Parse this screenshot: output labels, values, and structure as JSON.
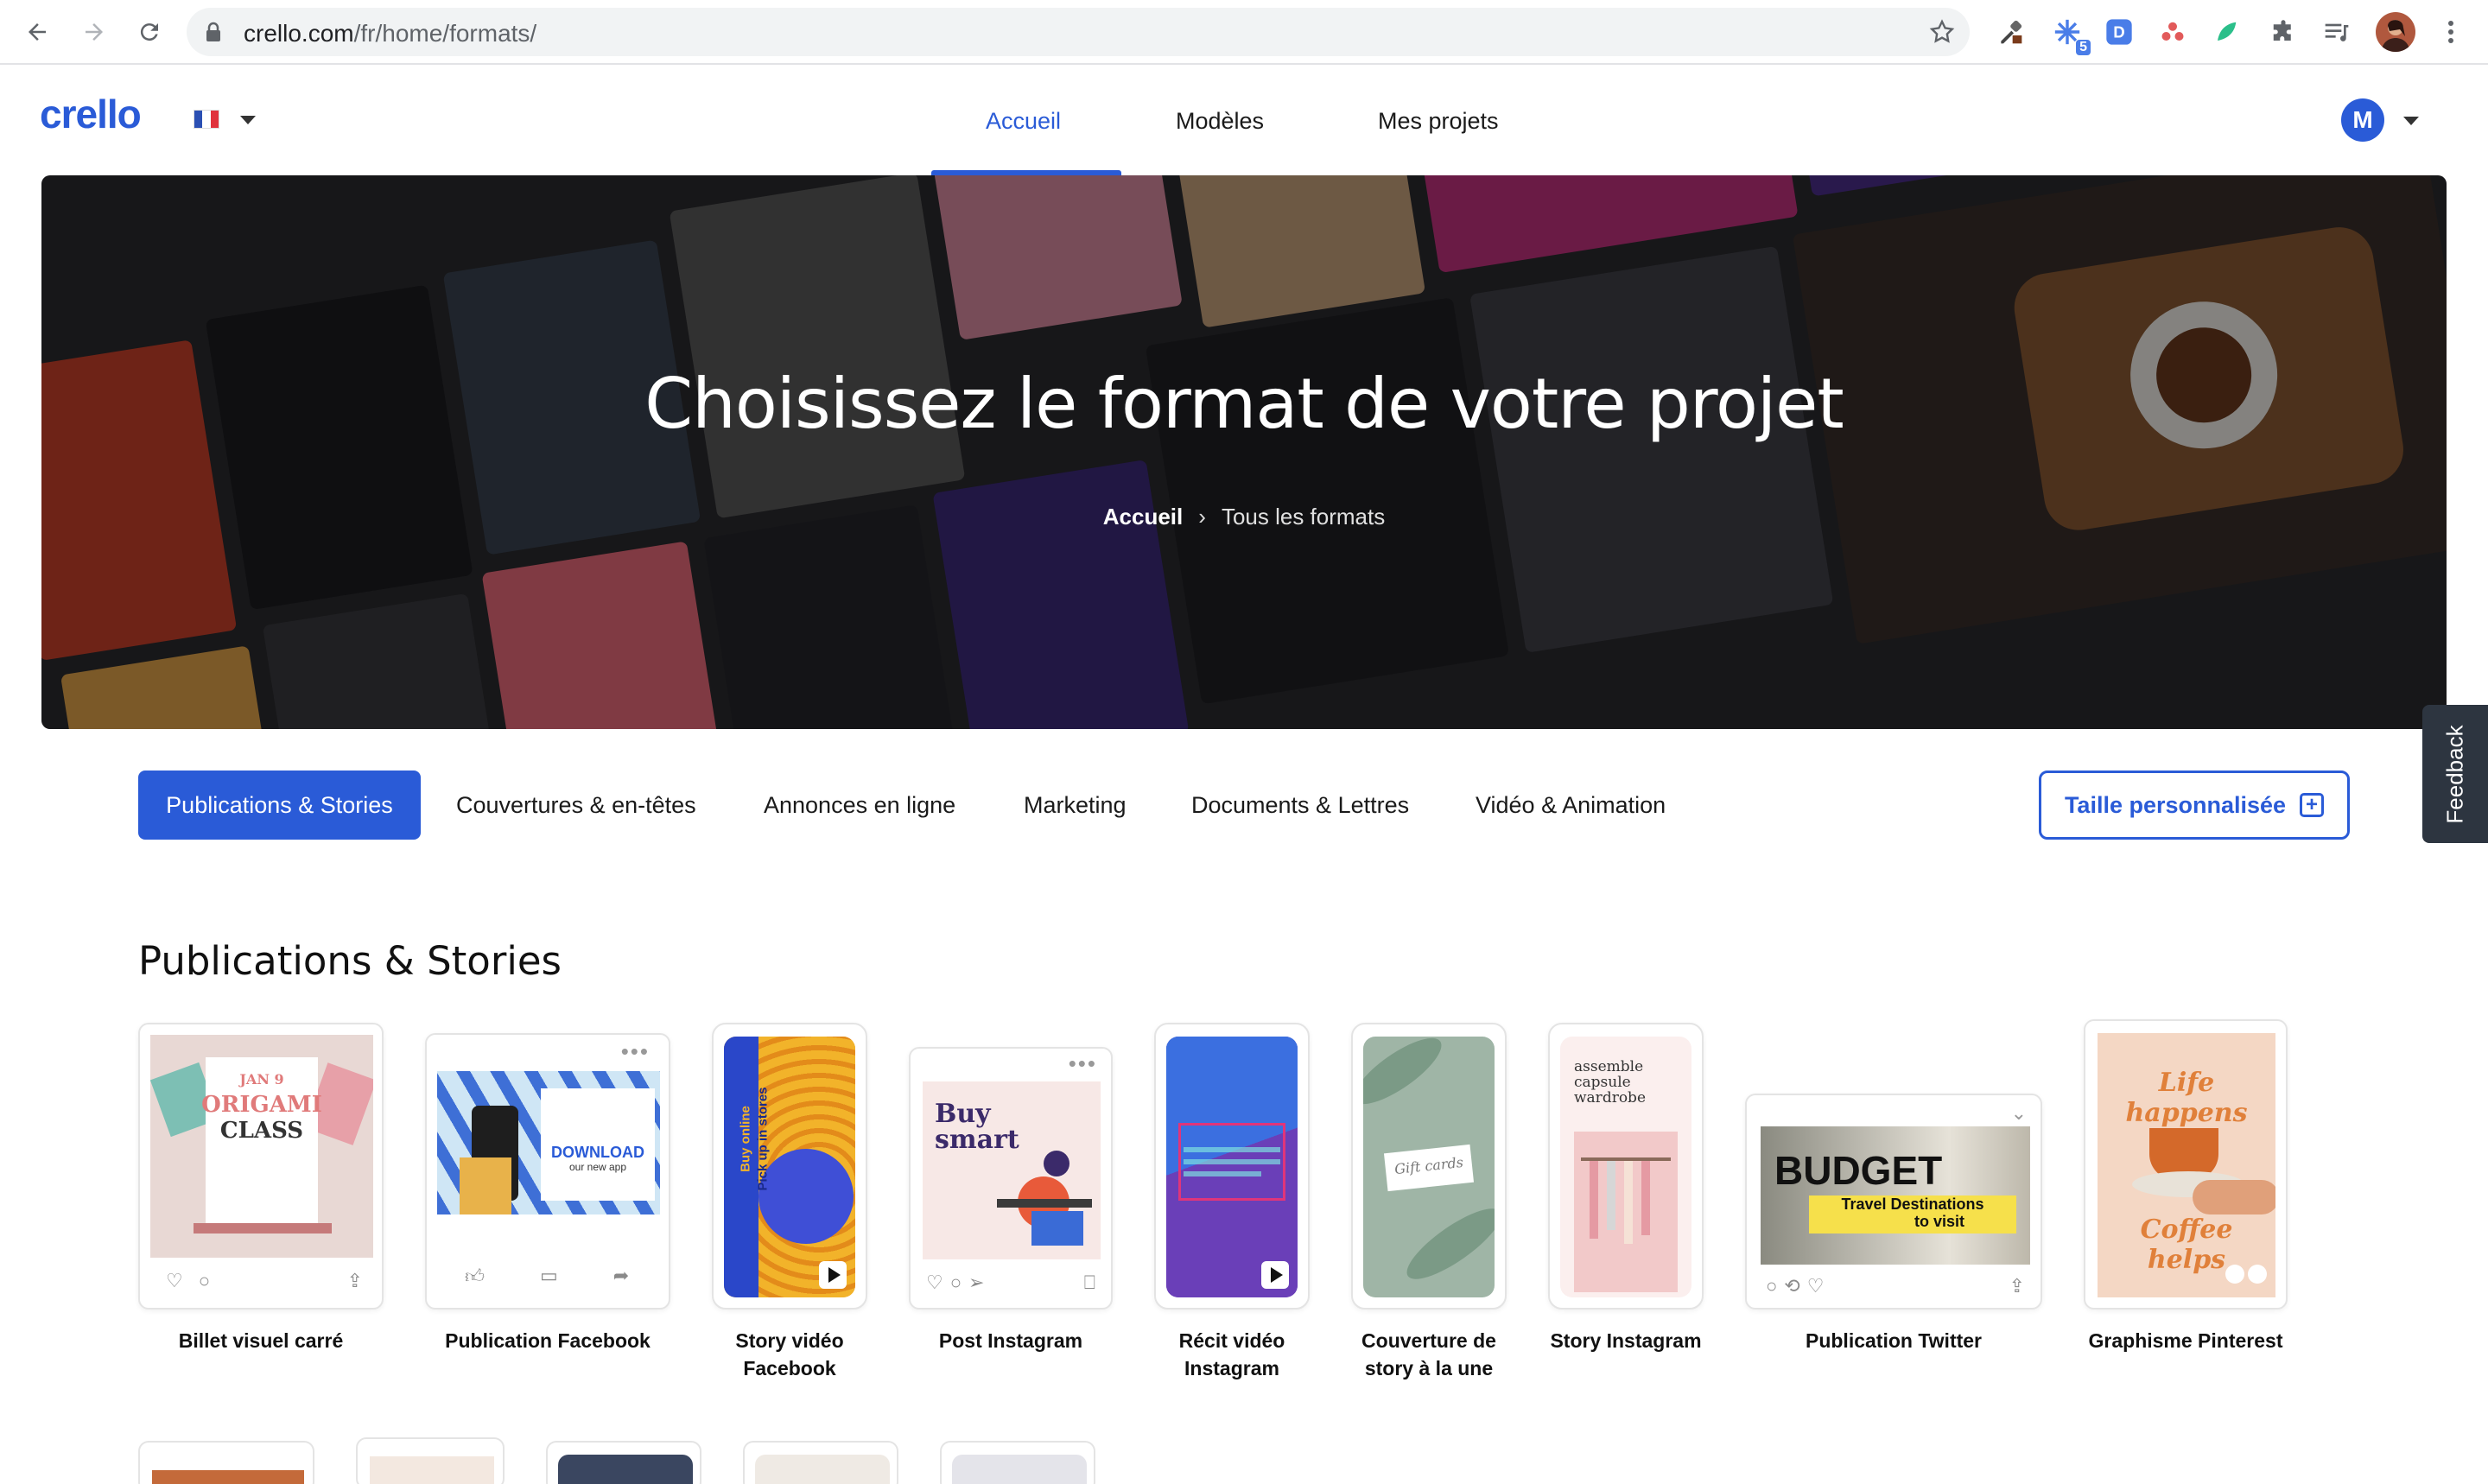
{
  "browser": {
    "url_host": "crello.com",
    "url_path": "/fr/home/formats/",
    "extension_badge": "5"
  },
  "header": {
    "logo": "crello",
    "nav": [
      "Accueil",
      "Modèles",
      "Mes projets"
    ],
    "active_nav": "Accueil",
    "avatar_initial": "M"
  },
  "hero": {
    "title": "Choisissez le format de votre projet",
    "breadcrumb": [
      "Accueil",
      "Tous les formats"
    ]
  },
  "categories": {
    "tabs": [
      "Publications & Stories",
      "Couvertures & en-têtes",
      "Annonces en ligne",
      "Marketing",
      "Documents & Lettres",
      "Vidéo & Animation"
    ],
    "active": "Publications & Stories",
    "custom_size": "Taille personnalisée"
  },
  "feedback": "Feedback",
  "section": {
    "title": "Publications & Stories",
    "cards": [
      {
        "label": "Billet visuel carré",
        "thumb": [
          "JAN 9",
          "ORIGAMI",
          "CLASS"
        ]
      },
      {
        "label": "Publication Facebook",
        "thumb": [
          "DOWNLOAD",
          "our new app"
        ]
      },
      {
        "label": "Story vidéo Facebook",
        "thumb": [
          "Buy online",
          "Pick up in stores"
        ]
      },
      {
        "label": "Post Instagram",
        "thumb": [
          "Buy",
          "smart"
        ]
      },
      {
        "label": "Récit vidéo Instagram",
        "thumb": []
      },
      {
        "label": "Couverture de story à la une",
        "thumb": [
          "Gift cards"
        ]
      },
      {
        "label": "Story Instagram",
        "thumb": [
          "assemble",
          "capsule",
          "wardrobe"
        ]
      },
      {
        "label": "Publication Twitter",
        "thumb": [
          "BUDGET",
          "Travel Destinations",
          "to visit"
        ]
      },
      {
        "label": "Graphisme Pinterest",
        "thumb": [
          "Life happens",
          "Coffee helps"
        ]
      }
    ]
  }
}
